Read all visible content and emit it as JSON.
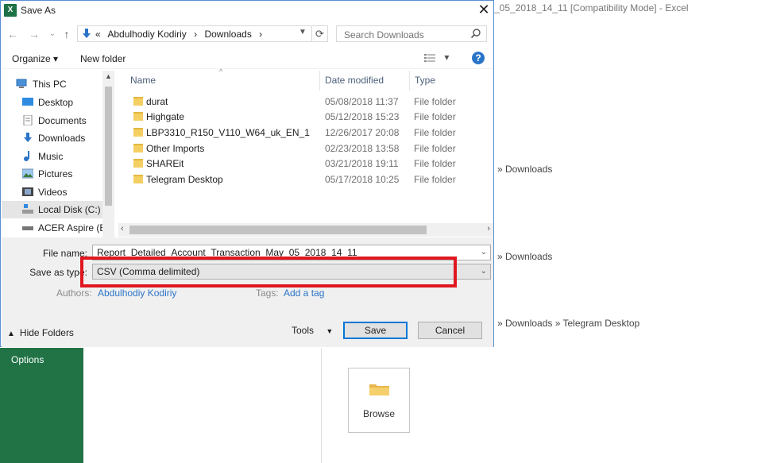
{
  "background": {
    "window_title": "_05_2018_14_11  [Compatibility Mode] - Excel",
    "options_label": "Options",
    "recent_paths": [
      "» Downloads",
      "» Downloads",
      "» Downloads » Telegram Desktop"
    ],
    "browse_label": "Browse",
    "accent_color": "#217346"
  },
  "dialog": {
    "app_icon": "X",
    "title": "Save As",
    "close_glyph": "✕",
    "nav": {
      "back": "←",
      "forward": "→",
      "recent": "⌄",
      "up": "↑"
    },
    "address": {
      "prefix": "«",
      "crumbs": [
        "Abdulhodiy Kodiriy",
        "Downloads"
      ],
      "separator": "›"
    },
    "search_placeholder": "Search Downloads",
    "toolbar": {
      "organize": "Organize ▾",
      "new_folder": "New folder",
      "view": "▾",
      "help": "?"
    },
    "nav_pane": [
      {
        "label": "This PC",
        "icon": "computer-icon"
      },
      {
        "label": "Desktop",
        "icon": "desktop-icon"
      },
      {
        "label": "Documents",
        "icon": "documents-icon"
      },
      {
        "label": "Downloads",
        "icon": "downloads-icon"
      },
      {
        "label": "Music",
        "icon": "music-icon"
      },
      {
        "label": "Pictures",
        "icon": "pictures-icon"
      },
      {
        "label": "Videos",
        "icon": "videos-icon"
      },
      {
        "label": "Local Disk (C:)",
        "icon": "disk-icon",
        "selected": true
      },
      {
        "label": "ACER Aspire (E:)",
        "icon": "drive-icon"
      }
    ],
    "columns": {
      "name": "Name",
      "date": "Date modified",
      "type": "Type"
    },
    "files": [
      {
        "name": "durat",
        "date": "05/08/2018 11:37",
        "type": "File folder"
      },
      {
        "name": "Highgate",
        "date": "05/12/2018 15:23",
        "type": "File folder"
      },
      {
        "name": "LBP3310_R150_V110_W64_uk_EN_1",
        "date": "12/26/2017 20:08",
        "type": "File folder"
      },
      {
        "name": "Other Imports",
        "date": "02/23/2018 13:58",
        "type": "File folder"
      },
      {
        "name": "SHAREit",
        "date": "03/21/2018 19:11",
        "type": "File folder"
      },
      {
        "name": "Telegram Desktop",
        "date": "05/17/2018 10:25",
        "type": "File folder"
      }
    ],
    "form": {
      "file_name_label": "File name:",
      "file_name_value": "Report_Detailed_Account_Transaction_May_05_2018_14_11",
      "save_type_label": "Save as type:",
      "save_type_value": "CSV (Comma delimited)",
      "authors_label": "Authors:",
      "authors_value": "Abdulhodiy Kodiriy",
      "tags_label": "Tags:",
      "tags_value": "Add a tag"
    },
    "footer": {
      "hide_folders": "Hide Folders",
      "tools": "Tools",
      "save": "Save",
      "cancel": "Cancel"
    },
    "highlight_color": "#e0171f"
  }
}
